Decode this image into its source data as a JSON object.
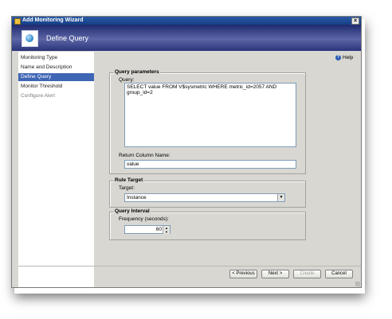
{
  "window": {
    "title": "Add Monitoring Wizard",
    "close_glyph": "×"
  },
  "header": {
    "title": "Define Query",
    "icon": "wizard-globe-icon"
  },
  "sidebar": {
    "items": [
      {
        "label": "Monitoring Type",
        "state": "normal"
      },
      {
        "label": "Name and Description",
        "state": "normal"
      },
      {
        "label": "Define Query",
        "state": "selected"
      },
      {
        "label": "Monitor Threshold",
        "state": "normal"
      },
      {
        "label": "Configure Alert",
        "state": "disabled"
      }
    ]
  },
  "help": {
    "label": "Help",
    "icon": "help-icon",
    "icon_glyph": "?"
  },
  "query_parameters": {
    "title": "Query parameters",
    "query_label": "Query:",
    "query_value": "SELECT value FROM V$sysmetric WHERE metric_id=2057 AND group_id=2",
    "return_column_label": "Return Column Name:",
    "return_column_value": "value"
  },
  "rule_target": {
    "title": "Rule Target",
    "target_label": "Target:",
    "target_value": "Instance",
    "arrow_glyph": "▼"
  },
  "query_interval": {
    "title": "Query Interval",
    "frequency_label": "Frequency (seconds):",
    "frequency_value": "60",
    "up_glyph": "▲",
    "down_glyph": "▼"
  },
  "buttons": {
    "previous": "< Previous",
    "next": "Next >",
    "create": "Create",
    "cancel": "Cancel"
  },
  "colors": {
    "title_bar": "#1f4a95",
    "header": "#4a5597",
    "selected_nav": "#3f66b5",
    "dialog_bg": "#d8d7d1"
  }
}
